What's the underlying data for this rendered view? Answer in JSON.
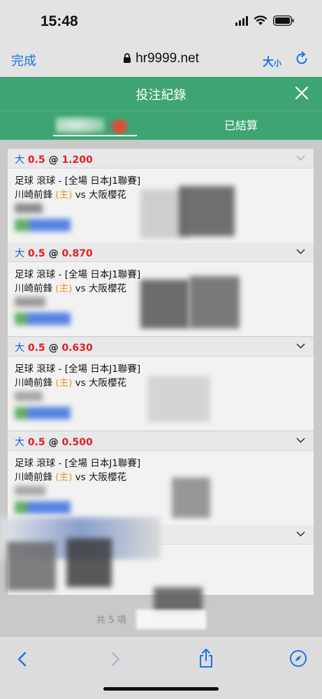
{
  "status": {
    "time": "15:48"
  },
  "browser": {
    "done_label": "完成",
    "url": "hr9999.net",
    "size_big": "大",
    "size_small": "小"
  },
  "header": {
    "title": "投注紀錄"
  },
  "tabs": [
    {
      "label": ""
    },
    {
      "label": "已結算"
    }
  ],
  "bets": [
    {
      "direction": "大",
      "line": "0.5",
      "at": "@",
      "odds": "1.200",
      "sport": "足球 滾球 - [全場 日本J1聯賽]",
      "home": "川崎前鋒",
      "home_tag": "(主)",
      "vs": "vs",
      "away": "大阪櫻花"
    },
    {
      "direction": "大",
      "line": "0.5",
      "at": "@",
      "odds": "0.870",
      "sport": "足球 滾球 - [全場 日本J1聯賽]",
      "home": "川崎前鋒",
      "home_tag": "(主)",
      "vs": "vs",
      "away": "大阪櫻花"
    },
    {
      "direction": "大",
      "line": "0.5",
      "at": "@",
      "odds": "0.630",
      "sport": "足球 滾球 - [全場 日本J1聯賽]",
      "home": "川崎前鋒",
      "home_tag": "(主)",
      "vs": "vs",
      "away": "大阪櫻花"
    },
    {
      "direction": "大",
      "line": "0.5",
      "at": "@",
      "odds": "0.500",
      "sport": "足球 滾球 - [全場 日本J1聯賽]",
      "home": "川崎前鋒",
      "home_tag": "(主)",
      "vs": "vs",
      "away": "大阪櫻花"
    }
  ],
  "footer": {
    "total": "共 5 項"
  },
  "colors": {
    "accent": "#3ea572",
    "link": "#1a73e8",
    "odds": "#e02020",
    "home_tag": "#e8941a"
  },
  "icons": [
    "lock-icon",
    "reload-icon",
    "close-icon",
    "chevron-down-icon",
    "back-icon",
    "forward-icon",
    "share-icon",
    "compass-icon"
  ]
}
